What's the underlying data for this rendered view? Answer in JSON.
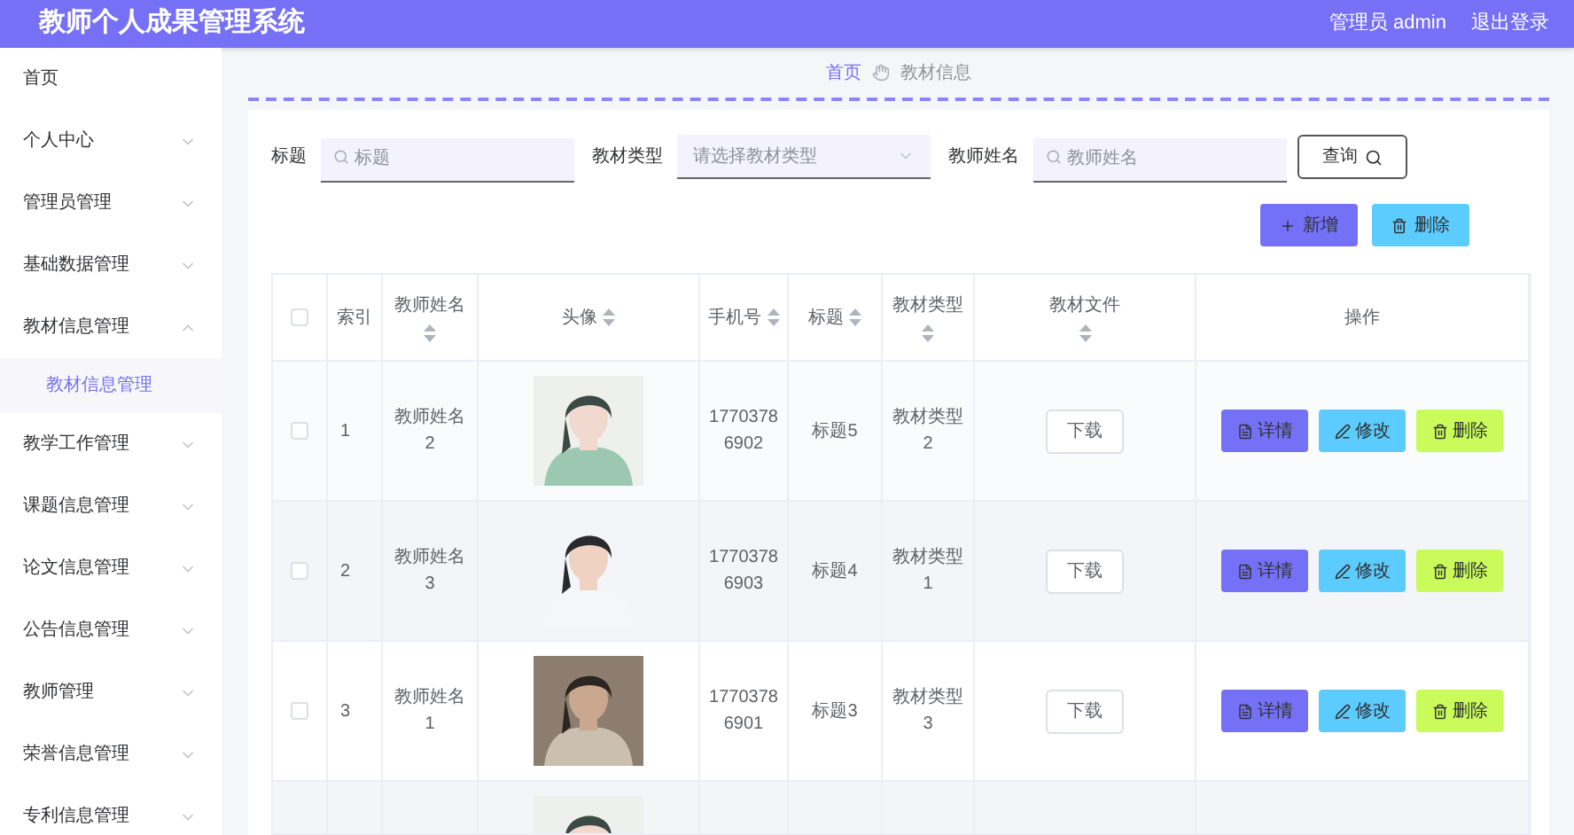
{
  "header": {
    "title": "教师个人成果管理系统",
    "user": "管理员 admin",
    "logout": "退出登录"
  },
  "sidebar": {
    "items": [
      {
        "label": "首页",
        "kind": "link"
      },
      {
        "label": "个人中心",
        "kind": "menu",
        "expanded": false
      },
      {
        "label": "管理员管理",
        "kind": "menu",
        "expanded": false
      },
      {
        "label": "基础数据管理",
        "kind": "menu",
        "expanded": false
      },
      {
        "label": "教材信息管理",
        "kind": "menu",
        "expanded": true,
        "children": [
          {
            "label": "教材信息管理",
            "selected": true
          }
        ]
      },
      {
        "label": "教学工作管理",
        "kind": "menu",
        "expanded": false
      },
      {
        "label": "课题信息管理",
        "kind": "menu",
        "expanded": false
      },
      {
        "label": "论文信息管理",
        "kind": "menu",
        "expanded": false
      },
      {
        "label": "公告信息管理",
        "kind": "menu",
        "expanded": false
      },
      {
        "label": "教师管理",
        "kind": "menu",
        "expanded": false
      },
      {
        "label": "荣誉信息管理",
        "kind": "menu",
        "expanded": false
      },
      {
        "label": "专利信息管理",
        "kind": "menu",
        "expanded": false
      }
    ]
  },
  "breadcrumb": [
    "首页",
    "教材信息"
  ],
  "filters": [
    {
      "label": "标题",
      "kind": "input",
      "placeholder": "标题"
    },
    {
      "label": "教材类型",
      "kind": "select",
      "placeholder": "请选择教材类型"
    },
    {
      "label": "教师姓名",
      "kind": "input",
      "placeholder": "教师姓名"
    }
  ],
  "query_button": "查询",
  "actions": [
    {
      "label": "新增",
      "kind": "add"
    },
    {
      "label": "删除",
      "kind": "delete"
    }
  ],
  "table": {
    "columns": [
      {
        "kind": "checkbox",
        "checked": false
      },
      {
        "label": "索引",
        "sortable": false
      },
      {
        "label": "教师姓名",
        "sortable": true
      },
      {
        "label": "头像",
        "sortable": true
      },
      {
        "label": "手机号",
        "sortable": true
      },
      {
        "label": "标题",
        "sortable": true
      },
      {
        "label": "教材类型",
        "sortable": true
      },
      {
        "label": "教材文件",
        "sortable": true
      },
      {
        "label": "操作",
        "sortable": false
      }
    ],
    "rows": [
      {
        "checked": false,
        "index": "1",
        "teacher": "教师姓名2",
        "phone": "17703786902",
        "title": "标题5",
        "type": "教材类型2",
        "file": "下载",
        "buttons": [
          "详情",
          "修改",
          "删除"
        ]
      },
      {
        "checked": false,
        "index": "2",
        "teacher": "教师姓名3",
        "phone": "17703786903",
        "title": "标题4",
        "type": "教材类型1",
        "file": "下载",
        "buttons": [
          "详情",
          "修改",
          "删除"
        ]
      },
      {
        "checked": false,
        "index": "3",
        "teacher": "教师姓名1",
        "phone": "17703786901",
        "title": "标题3",
        "type": "教材类型3",
        "file": "下载",
        "buttons": [
          "详情",
          "修改",
          "删除"
        ]
      }
    ]
  }
}
